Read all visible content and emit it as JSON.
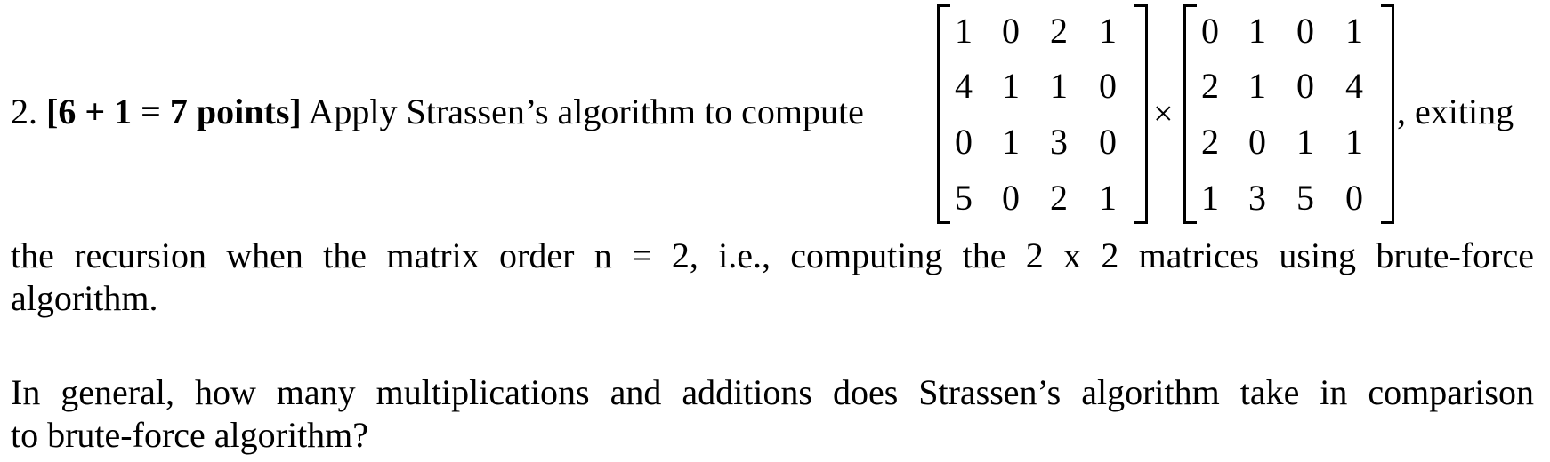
{
  "question": {
    "number": "2.",
    "points": "[6 + 1 = 7 points]",
    "line1_text": "Apply Strassen’s algorithm to compute",
    "operator": "×",
    "after_matrices": ", exiting",
    "line2": "the recursion when the matrix order n = 2, i.e., computing the 2 x 2 matrices using brute-force",
    "line2b": "algorithm.",
    "followup_line1": "In general, how many multiplications and additions does Strassen’s algorithm take in comparison",
    "followup_line2": "to brute-force algorithm?"
  },
  "matrix_a": [
    [
      "1",
      "0",
      "2",
      "1"
    ],
    [
      "4",
      "1",
      "1",
      "0"
    ],
    [
      "0",
      "1",
      "3",
      "0"
    ],
    [
      "5",
      "0",
      "2",
      "1"
    ]
  ],
  "matrix_b": [
    [
      "0",
      "1",
      "0",
      "1"
    ],
    [
      "2",
      "1",
      "0",
      "4"
    ],
    [
      "2",
      "0",
      "1",
      "1"
    ],
    [
      "1",
      "3",
      "5",
      "0"
    ]
  ]
}
